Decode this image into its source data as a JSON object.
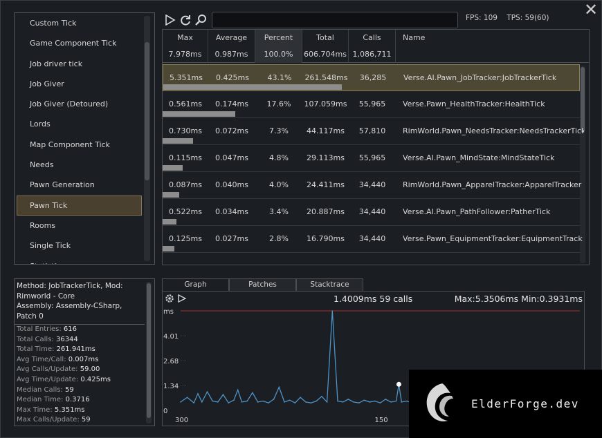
{
  "categories": [
    {
      "label": "Custom Tick",
      "selected": false
    },
    {
      "label": "Game Component Tick",
      "selected": false
    },
    {
      "label": "Job driver tick",
      "selected": false
    },
    {
      "label": "Job Giver",
      "selected": false
    },
    {
      "label": "Job Giver (Detoured)",
      "selected": false
    },
    {
      "label": "Lords",
      "selected": false
    },
    {
      "label": "Map Component Tick",
      "selected": false
    },
    {
      "label": "Needs",
      "selected": false
    },
    {
      "label": "Pawn Generation",
      "selected": false
    },
    {
      "label": "Pawn Tick",
      "selected": true
    },
    {
      "label": "Rooms",
      "selected": false
    },
    {
      "label": "Single Tick",
      "selected": false
    },
    {
      "label": "Statistics",
      "selected": false
    }
  ],
  "toolbar": {
    "icons": [
      "play-icon",
      "refresh-icon",
      "search-icon"
    ],
    "search_value": "",
    "fps": "FPS: 109",
    "tps": "TPS: 59(60)"
  },
  "table": {
    "columns": [
      {
        "label": "Max",
        "total": "7.978ms"
      },
      {
        "label": "Average",
        "total": "0.987ms"
      },
      {
        "label": "Percent",
        "total": "100.0%",
        "sorted": true
      },
      {
        "label": "Total",
        "total": "606.704ms"
      },
      {
        "label": "Calls",
        "total": "1,086,711"
      },
      {
        "label": "Name",
        "total": ""
      }
    ],
    "rows": [
      {
        "max": "5.351ms",
        "avg": "0.425ms",
        "pct": "43.1%",
        "pct_value": 43.1,
        "total": "261.548ms",
        "calls": "36,285",
        "name": "Verse.AI.Pawn_JobTracker:JobTrackerTick",
        "selected": true
      },
      {
        "max": "0.561ms",
        "avg": "0.174ms",
        "pct": "17.6%",
        "pct_value": 17.6,
        "total": "107.059ms",
        "calls": "55,965",
        "name": "Verse.Pawn_HealthTracker:HealthTick",
        "selected": false
      },
      {
        "max": "0.730ms",
        "avg": "0.072ms",
        "pct": "7.3%",
        "pct_value": 7.3,
        "total": "44.117ms",
        "calls": "57,810",
        "name": "RimWorld.Pawn_NeedsTracker:NeedsTrackerTick",
        "selected": false
      },
      {
        "max": "0.115ms",
        "avg": "0.047ms",
        "pct": "4.8%",
        "pct_value": 4.8,
        "total": "29.113ms",
        "calls": "55,965",
        "name": "Verse.AI.Pawn_MindState:MindStateTick",
        "selected": false
      },
      {
        "max": "0.087ms",
        "avg": "0.040ms",
        "pct": "4.0%",
        "pct_value": 4.0,
        "total": "24.411ms",
        "calls": "34,440",
        "name": "RimWorld.Pawn_ApparelTracker:ApparelTracker",
        "selected": false
      },
      {
        "max": "0.522ms",
        "avg": "0.034ms",
        "pct": "3.4%",
        "pct_value": 3.4,
        "total": "20.887ms",
        "calls": "34,440",
        "name": "Verse.AI.Pawn_PathFollower:PatherTick",
        "selected": false
      },
      {
        "max": "0.125ms",
        "avg": "0.027ms",
        "pct": "2.8%",
        "pct_value": 2.8,
        "total": "16.790ms",
        "calls": "34,440",
        "name": "Verse.Pawn_EquipmentTracker:EquipmentTrack",
        "selected": false
      }
    ]
  },
  "info": {
    "method": "Method: JobTrackerTick, Mod: Rimworld - Core",
    "assembly": "Assembly: Assembly-CSharp, Patch 0",
    "stats": [
      {
        "k": "Total Entries:",
        "v": "616"
      },
      {
        "k": "Total Calls:",
        "v": "36344"
      },
      {
        "k": "Total Time:",
        "v": "261.941ms"
      },
      {
        "k": "Avg Time/Call:",
        "v": "0.007ms"
      },
      {
        "k": "Avg Calls/Update:",
        "v": "59.00"
      },
      {
        "k": "Avg Time/Update:",
        "v": "0.425ms"
      },
      {
        "k": "Median Calls:",
        "v": "59"
      },
      {
        "k": "Median Time:",
        "v": "0.3716"
      },
      {
        "k": "Max Time:",
        "v": "5.351ms"
      },
      {
        "k": "Max Calls/Update:",
        "v": "59"
      }
    ]
  },
  "graph": {
    "tabs": [
      {
        "label": "Graph",
        "active": true
      },
      {
        "label": "Patches",
        "active": false
      },
      {
        "label": "Stacktrace",
        "active": false
      }
    ],
    "headline": "1.4009ms 59 calls",
    "maxmin": "Max:5.3506ms Min:0.3931ms",
    "y_unit": "ms",
    "y_ticks": [
      "4.01",
      "2.68",
      "1.34",
      "0"
    ],
    "x_ticks": [
      "300",
      "150"
    ],
    "line_color": "#4f93c7",
    "max_line_color": "#b02a2a"
  },
  "chart_data": {
    "type": "line",
    "title": "1.4009ms 59 calls",
    "ylabel": "ms",
    "ylim": [
      0,
      5.35
    ],
    "y_ticks": [
      0,
      1.34,
      2.68,
      4.01
    ],
    "x_ticks": [
      300,
      150
    ],
    "max_ms": 5.3506,
    "min_ms": 0.3931,
    "highlight": {
      "x": 136,
      "y": 1.4009
    },
    "series": [
      {
        "x": [
          300,
          295,
          290,
          287,
          284,
          280,
          276,
          272,
          268,
          264,
          260,
          257,
          254,
          250,
          246,
          242,
          238,
          234,
          230,
          226,
          222,
          218,
          214,
          210,
          206,
          202,
          198,
          194,
          190,
          186,
          182,
          178,
          174,
          170,
          166,
          162,
          158,
          154,
          150,
          146,
          142,
          138,
          136,
          134,
          130,
          126,
          122,
          118,
          114,
          110
        ],
        "values": [
          0.45,
          0.7,
          0.4,
          0.9,
          0.45,
          1.0,
          0.5,
          0.45,
          0.85,
          0.4,
          0.55,
          1.1,
          0.45,
          0.5,
          0.95,
          0.45,
          0.5,
          0.4,
          0.6,
          1.25,
          0.45,
          0.55,
          0.4,
          0.7,
          0.45,
          0.4,
          0.5,
          0.75,
          0.45,
          5.35,
          0.5,
          0.45,
          0.6,
          0.45,
          0.4,
          0.55,
          0.45,
          0.5,
          0.4,
          0.6,
          0.45,
          0.5,
          1.4,
          0.45,
          0.5,
          0.4,
          0.55,
          0.45,
          0.5,
          0.45
        ]
      }
    ]
  },
  "watermark": {
    "text": "ElderForge.dev"
  }
}
